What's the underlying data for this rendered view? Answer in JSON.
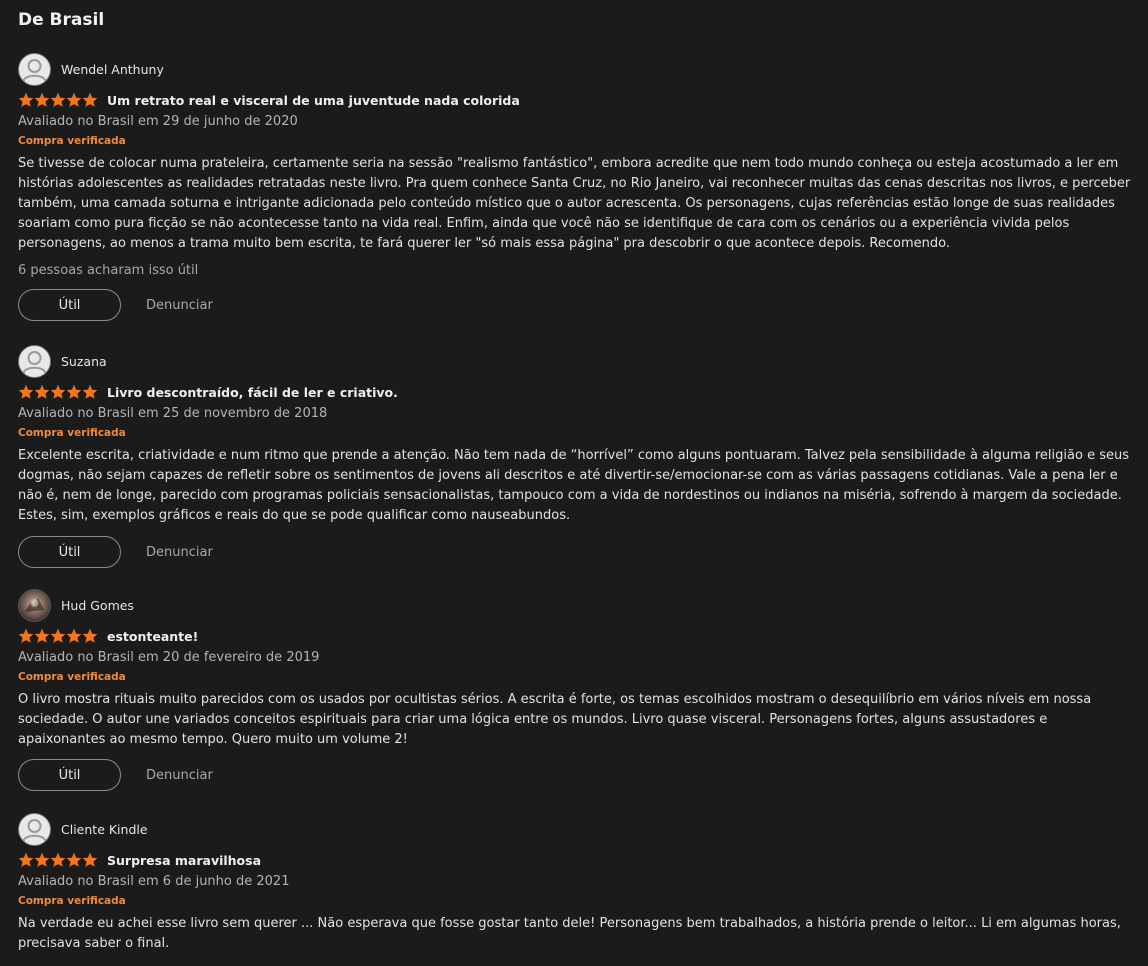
{
  "section": {
    "title": "De Brasil"
  },
  "colors": {
    "star": "#f4761b",
    "verified": "#f08a3c",
    "background": "#1b1b1b"
  },
  "reviews": [
    {
      "author": "Wendel Anthuny",
      "avatar": "default-avatar-icon",
      "rating": 5,
      "title": "Um retrato real e visceral de uma juventude nada colorida",
      "date": "Avaliado no Brasil em 29 de junho de 2020",
      "verified": "Compra verificada",
      "body": "Se tivesse de colocar numa prateleira, certamente seria na sessão \"realismo fantástico\", embora acredite que nem todo mundo conheça ou esteja acostumado a ler em histórias adolescentes as realidades retratadas neste livro. Pra quem conhece Santa Cruz, no Rio Janeiro, vai reconhecer muitas das cenas descritas nos livros, e perceber também, uma camada soturna e intrigante adicionada pelo conteúdo místico que o autor acrescenta. Os personagens, cujas referências estão longe de suas realidades soariam como pura ficção se não acontecesse tanto na vida real. Enfim, ainda que você não se identifique de cara com os cenários ou a experiência vivida pelos personagens, ao menos a trama muito bem escrita, te fará querer ler \"só mais essa página\" pra descobrir o que acontece depois. Recomendo.",
      "helpful_count": "6 pessoas acharam isso útil",
      "helpful_label": "Útil",
      "report_label": "Denunciar"
    },
    {
      "author": "Suzana",
      "avatar": "default-avatar-icon",
      "rating": 5,
      "title": "Livro descontraído, fácil de ler e criativo.",
      "date": "Avaliado no Brasil em 25 de novembro de 2018",
      "verified": "Compra verificada",
      "body": "Excelente escrita, criatividade e num ritmo que prende a atenção. Não tem nada de “horrível” como alguns pontuaram. Talvez pela sensibilidade à alguma religião e seus dogmas, não sejam capazes de refletir sobre os sentimentos de jovens ali descritos e até divertir-se/emocionar-se com as várias passagens cotidianas. Vale a pena ler e não é, nem de longe, parecido com programas policiais sensacionalistas, tampouco com a vida de nordestinos ou indianos na miséria, sofrendo à margem da sociedade. Estes, sim, exemplos gráficos e reais do que se pode qualificar como nauseabundos.",
      "helpful_label": "Útil",
      "report_label": "Denunciar"
    },
    {
      "author": "Hud Gomes",
      "avatar": "photo-avatar",
      "rating": 5,
      "title": "estonteante!",
      "date": "Avaliado no Brasil em 20 de fevereiro de 2019",
      "verified": "Compra verificada",
      "body": "O livro mostra rituais muito parecidos com os usados por ocultistas sérios. A escrita é forte, os temas escolhidos mostram o desequilíbrio em vários níveis em nossa sociedade. O autor une variados conceitos espirituais para criar uma lógica entre os mundos. Livro quase visceral. Personagens fortes, alguns assustadores e apaixonantes ao mesmo tempo. Quero muito um volume 2!",
      "helpful_label": "Útil",
      "report_label": "Denunciar"
    },
    {
      "author": "Cliente Kindle",
      "avatar": "default-avatar-icon",
      "rating": 5,
      "title": "Surpresa maravilhosa",
      "date": "Avaliado no Brasil em 6 de junho de 2021",
      "verified": "Compra verificada",
      "body": "Na verdade eu achei esse livro sem querer ... Não esperava que fosse gostar tanto dele! Personagens bem trabalhados, a história prende o leitor... Li em algumas horas, precisava saber o final."
    }
  ]
}
